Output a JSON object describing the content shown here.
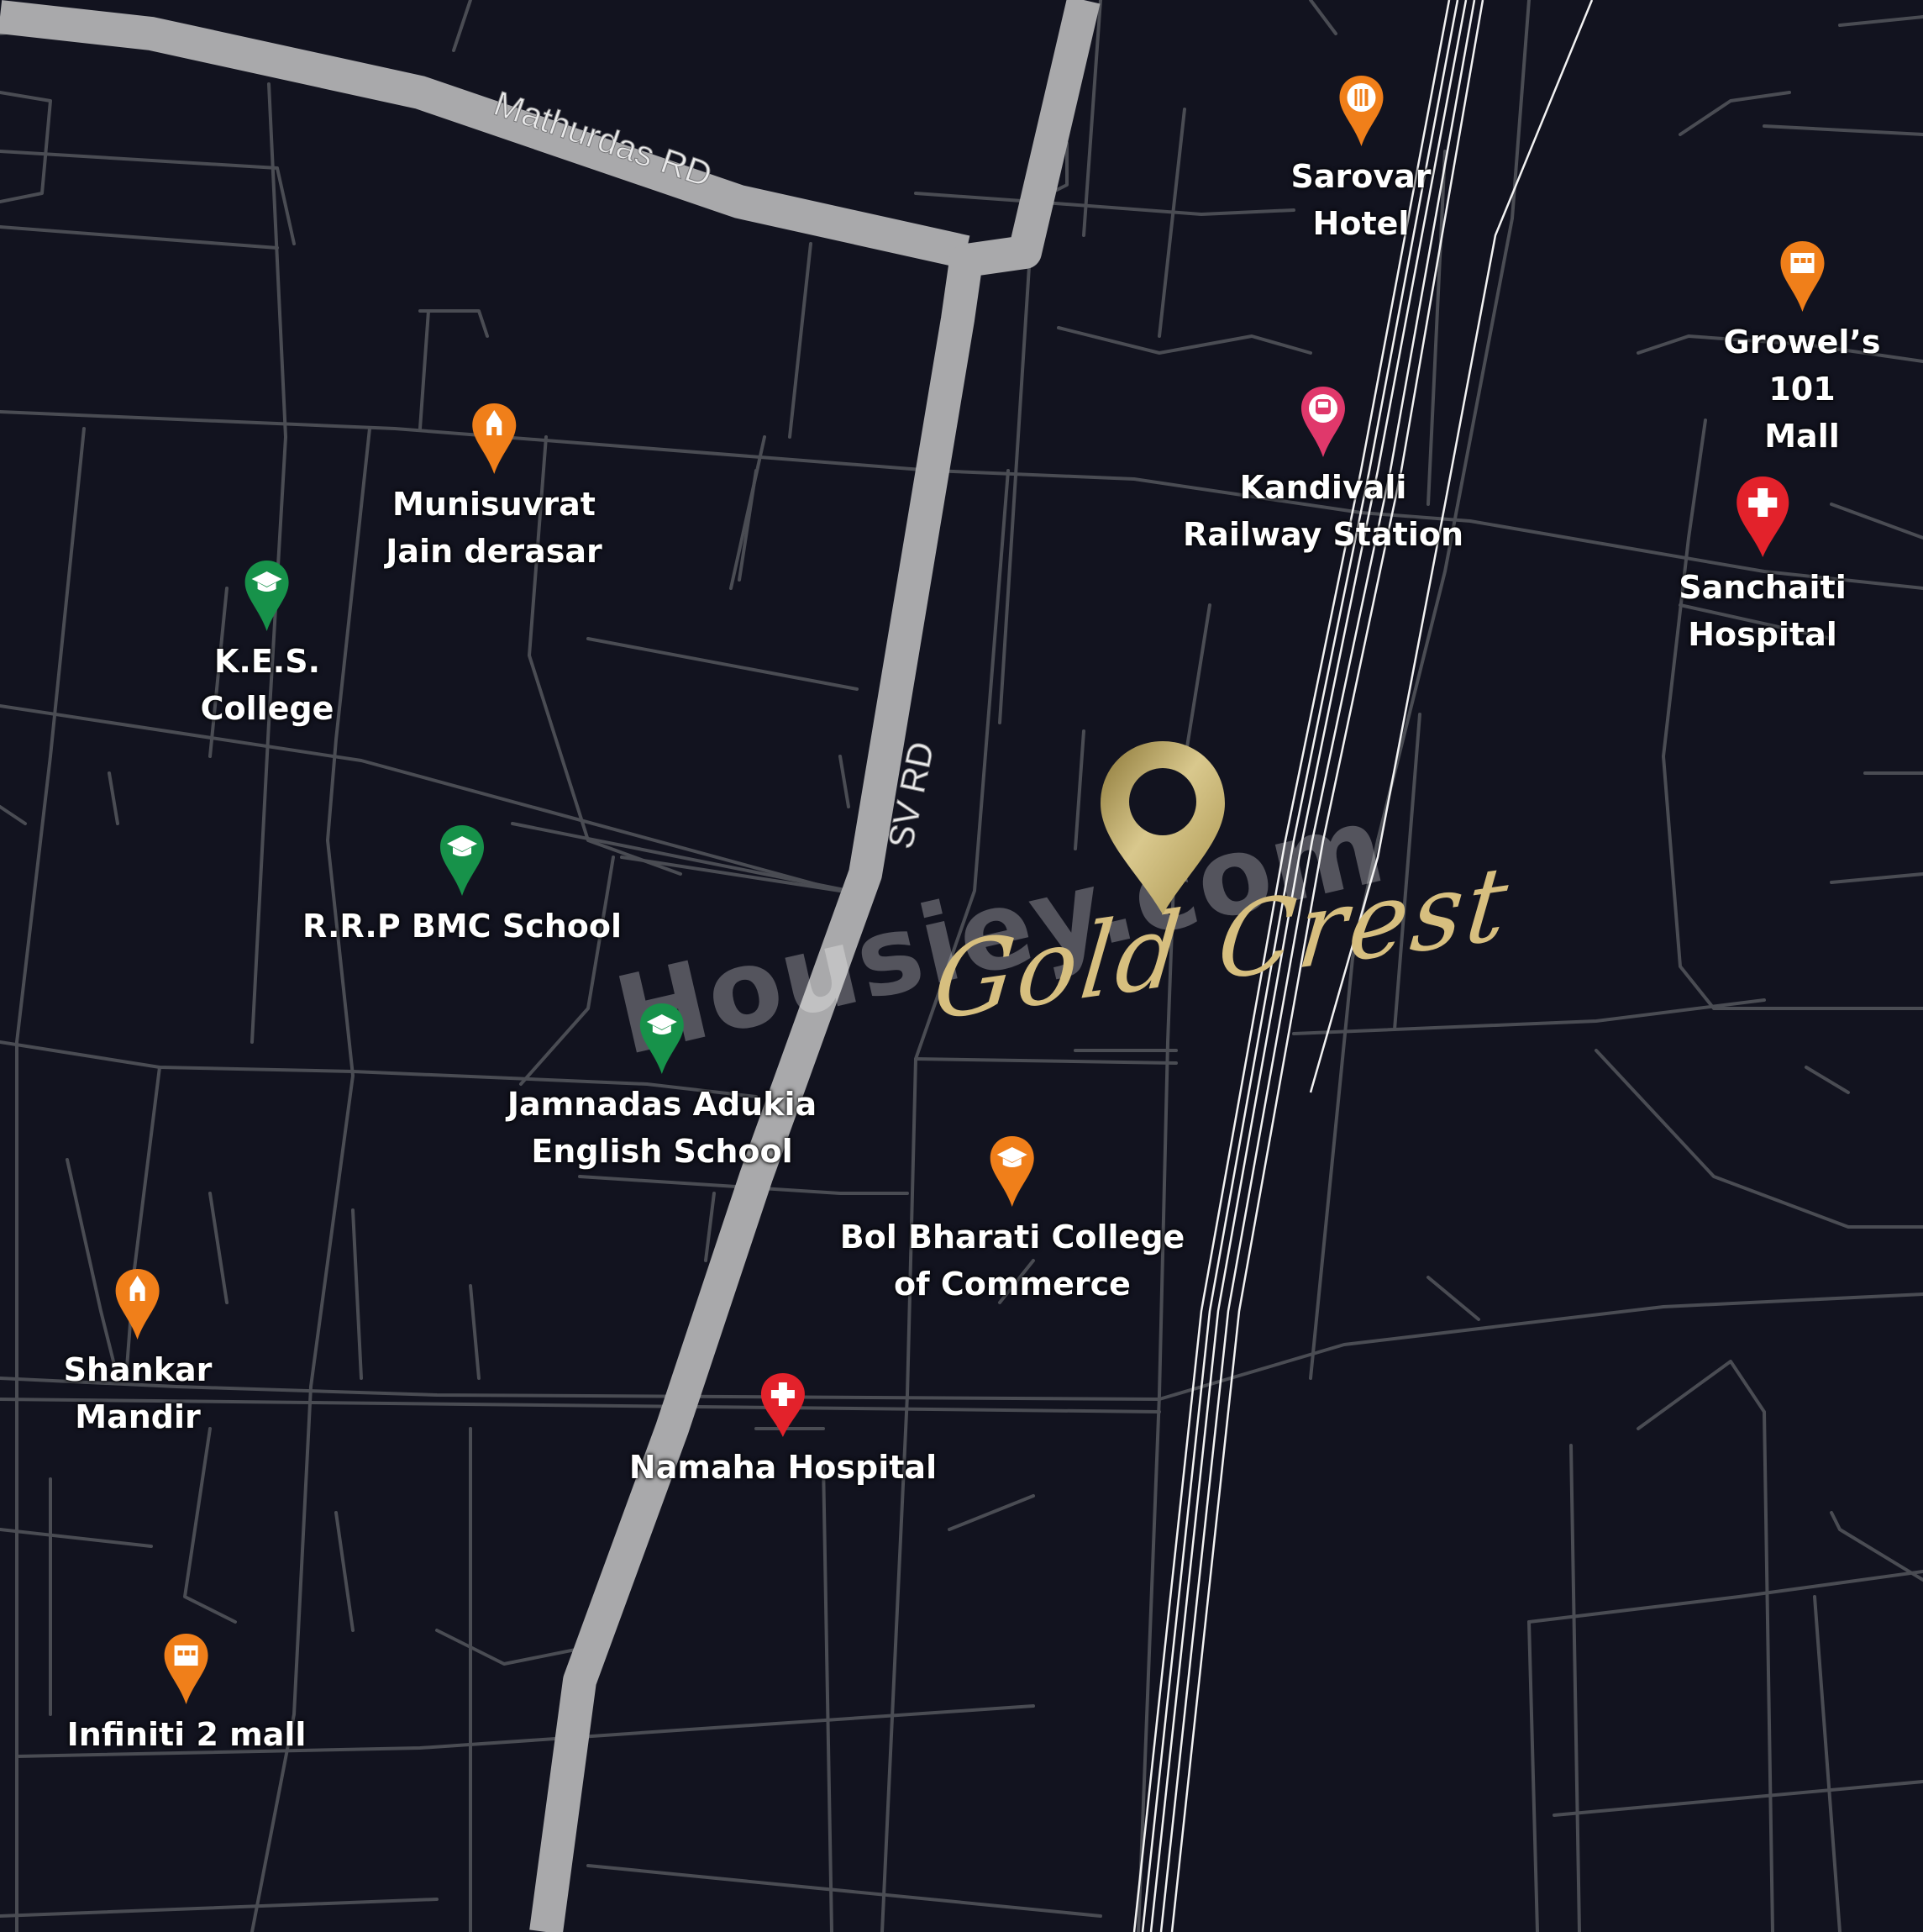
{
  "map": {
    "roads": {
      "mathurdas": "Mathurdas RD",
      "sv_rd": "SV RD"
    },
    "project_brand": "Gold Crest",
    "watermark": "Housiey.com",
    "pois": [
      {
        "id": "sarovar-hotel",
        "label": "Sarovar\nHotel",
        "category": "hotel",
        "color": "#f07f1a",
        "icon": "fork-knife-icon"
      },
      {
        "id": "growels-101-mall",
        "label": "Growel’s 101\nMall",
        "category": "mall",
        "color": "#f07f1a",
        "icon": "mall-icon"
      },
      {
        "id": "kandivali-railway-station",
        "label": "Kandivali\nRailway Station",
        "category": "station",
        "color": "#e0386b",
        "icon": "train-icon"
      },
      {
        "id": "sanchaiti-hospital",
        "label": "Sanchaiti\nHospital",
        "category": "hospital",
        "color": "#e3222b",
        "icon": "medical-cross-icon"
      },
      {
        "id": "munisuvrat-jain-derasar",
        "label": "Munisuvrat\nJain derasar",
        "category": "temple",
        "color": "#f07f1a",
        "icon": "temple-icon"
      },
      {
        "id": "kes-college",
        "label": "K.E.S.\nCollege",
        "category": "education",
        "color": "#17924a",
        "icon": "graduation-cap-icon"
      },
      {
        "id": "rrp-bmc-school",
        "label": "R.R.P BMC School",
        "category": "education",
        "color": "#17924a",
        "icon": "graduation-cap-icon"
      },
      {
        "id": "jamnadas-adukia-english-school",
        "label": "Jamnadas Adukia\nEnglish School",
        "category": "education",
        "color": "#17924a",
        "icon": "graduation-cap-icon"
      },
      {
        "id": "bol-bharati-college",
        "label": "Bol Bharati College\nof Commerce",
        "category": "education",
        "color": "#f07f1a",
        "icon": "graduation-cap-icon"
      },
      {
        "id": "shankar-mandir",
        "label": "Shankar\nMandir",
        "category": "temple",
        "color": "#f07f1a",
        "icon": "temple-icon"
      },
      {
        "id": "namaha-hospital",
        "label": "Namaha Hospital",
        "category": "hospital",
        "color": "#e3222b",
        "icon": "medical-cross-icon"
      },
      {
        "id": "infiniti-2-mall",
        "label": "Infiniti 2 mall",
        "category": "mall",
        "color": "#f07f1a",
        "icon": "mall-icon"
      }
    ]
  }
}
